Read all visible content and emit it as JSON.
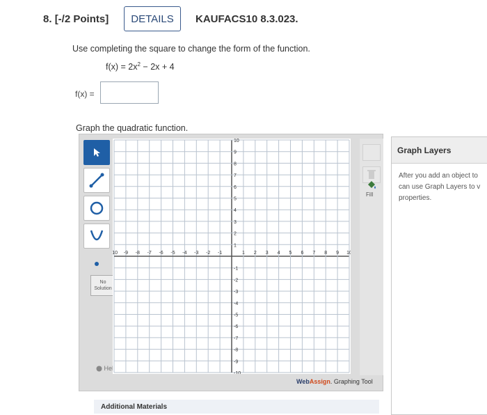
{
  "question": {
    "number": "8.",
    "points": "[-/2 Points]",
    "details_label": "DETAILS",
    "code": "KAUFACS10 8.3.023."
  },
  "prompt": "Use completing the square to change the form of the function.",
  "function_lhs": "f(x) = 2x",
  "function_exp": "2",
  "function_rhs": " − 2x + 4",
  "answer": {
    "label": "f(x) =",
    "value": ""
  },
  "graph_prompt": "Graph the quadratic function.",
  "tools": {
    "no_solution": [
      "No",
      "Solution"
    ],
    "help": "Help",
    "fill": "Fill"
  },
  "axis": {
    "x_ticks": [
      "-10",
      "-9",
      "-8",
      "-7",
      "-6",
      "-5",
      "-4",
      "-3",
      "-2",
      "-1",
      "1",
      "2",
      "3",
      "4",
      "5",
      "6",
      "7",
      "8",
      "9",
      "10"
    ],
    "y_ticks": [
      "10",
      "9",
      "8",
      "7",
      "6",
      "5",
      "4",
      "3",
      "2",
      "1",
      "-1",
      "-2",
      "-3",
      "-4",
      "-5",
      "-6",
      "-7",
      "-8",
      "-9",
      "-10"
    ],
    "range": [
      -10,
      10
    ]
  },
  "brand": {
    "web": "Web",
    "assign": "Assign",
    "suffix": ". Graphing Tool"
  },
  "layers": {
    "title": "Graph Layers",
    "body": [
      "After you add an object to",
      "can use Graph Layers to v",
      "properties."
    ]
  },
  "additional": "Additional Materials"
}
